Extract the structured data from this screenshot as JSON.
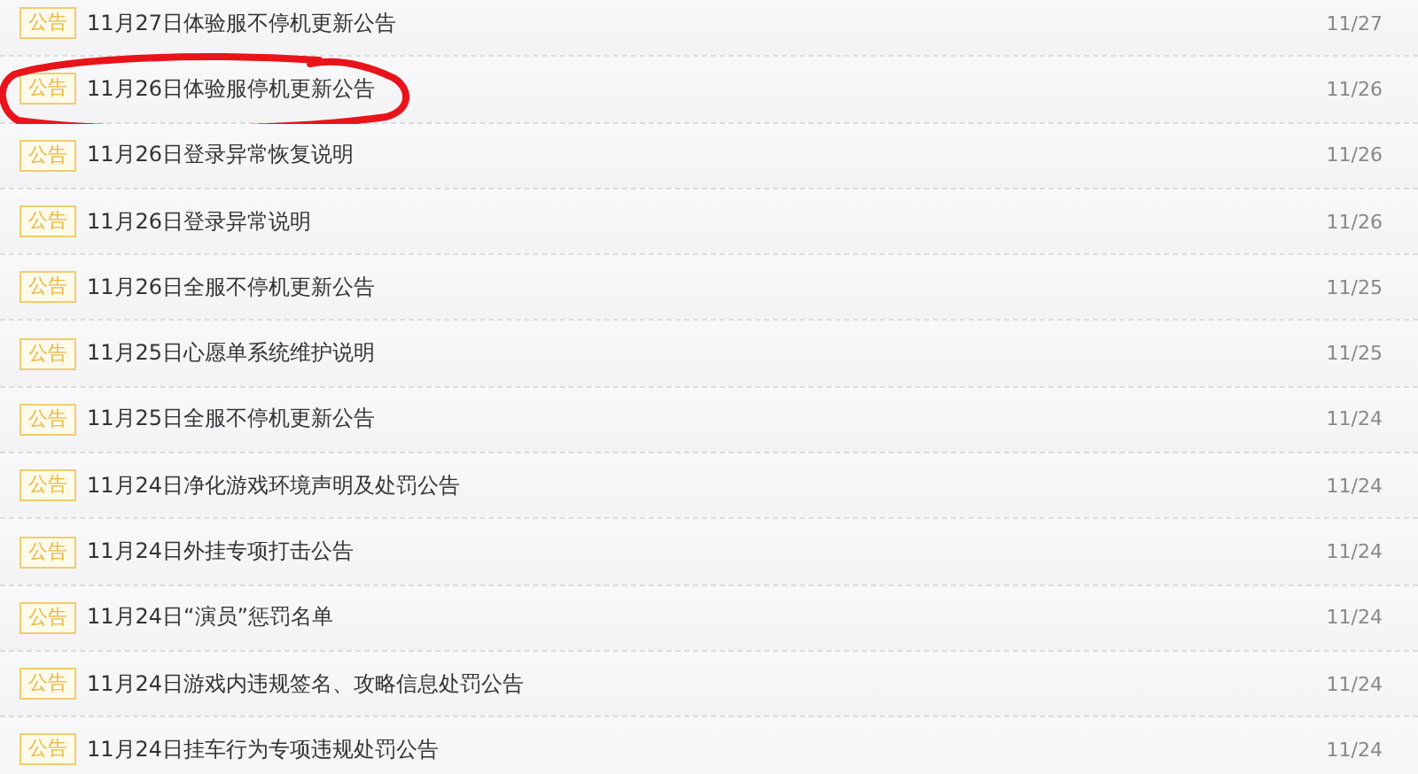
{
  "notices": [
    {
      "tag": "公告",
      "title": "11月27日体验服不停机更新公告",
      "date": "11/27",
      "circled": false
    },
    {
      "tag": "公告",
      "title": "11月26日体验服停机更新公告",
      "date": "11/26",
      "circled": true
    },
    {
      "tag": "公告",
      "title": "11月26日登录异常恢复说明",
      "date": "11/26",
      "circled": false
    },
    {
      "tag": "公告",
      "title": "11月26日登录异常说明",
      "date": "11/26",
      "circled": false
    },
    {
      "tag": "公告",
      "title": "11月26日全服不停机更新公告",
      "date": "11/25",
      "circled": false
    },
    {
      "tag": "公告",
      "title": "11月25日心愿单系统维护说明",
      "date": "11/25",
      "circled": false
    },
    {
      "tag": "公告",
      "title": "11月25日全服不停机更新公告",
      "date": "11/24",
      "circled": false
    },
    {
      "tag": "公告",
      "title": "11月24日净化游戏环境声明及处罚公告",
      "date": "11/24",
      "circled": false
    },
    {
      "tag": "公告",
      "title": "11月24日外挂专项打击公告",
      "date": "11/24",
      "circled": false
    },
    {
      "tag": "公告",
      "title": "11月24日“演员”惩罚名单",
      "date": "11/24",
      "circled": false
    },
    {
      "tag": "公告",
      "title": "11月24日游戏内违规签名、攻略信息处罚公告",
      "date": "11/24",
      "circled": false
    },
    {
      "tag": "公告",
      "title": "11月24日挂车行为专项违规处罚公告",
      "date": "11/24",
      "circled": false
    }
  ]
}
